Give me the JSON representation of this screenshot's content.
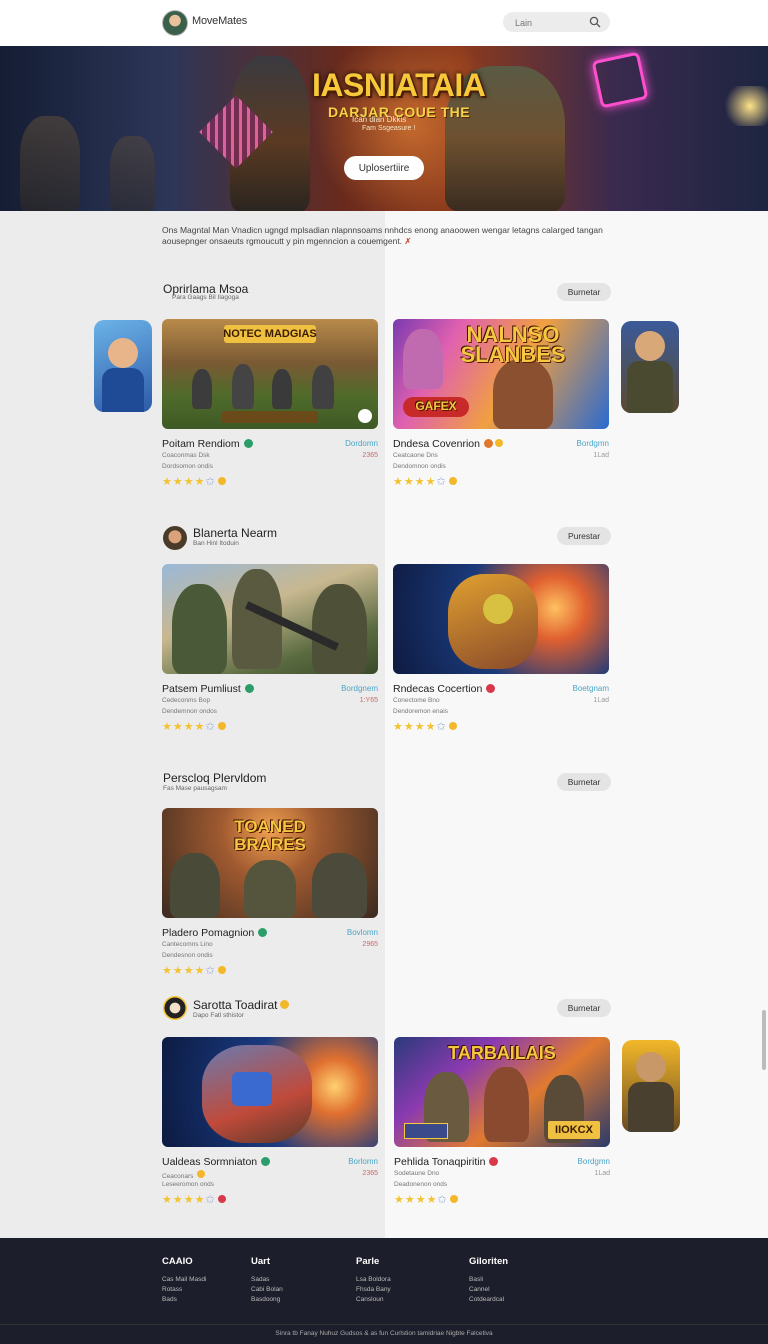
{
  "header": {
    "brand": "MoveMates",
    "search_placeholder": "Lain"
  },
  "hero": {
    "title_top": "DARJAR COUE THE",
    "title_main": "IASNIATAIA",
    "sub1": "Ican dian Dkkis",
    "sub2": "Fam Ssgeasure !",
    "button": "Uplosertiire"
  },
  "intro": {
    "text": "Ons Magntal Man Vnadicn ugngd mplsadian nlapnnsoams nnhdcs enong anaoowen wengar letagns calarged tangan aousepnger onsaeuts rgmoucutt y pin mgenncion a couemgent.",
    "tag": "✗"
  },
  "sections": [
    {
      "title": "Oprirlama Msoa",
      "subtitle": "Para Gaags Bil Ilagoga",
      "button": "Burnetar",
      "cards": [
        {
          "thumb_title": "NOTEC MADGIAS",
          "name": "Poitam Rendiom",
          "badge_color": "#2a9d6a",
          "link": "Dordomn",
          "num": "2365",
          "line1": "Coaconmas Dsk",
          "line2": "Dordsomon ondis"
        },
        {
          "thumb_title": "NALNSO SLANBES",
          "thumb_title2": "GAFEX",
          "name": "Dndesa Covenrion",
          "badge_color": "#e0782a",
          "link": "Bordgmn",
          "num": "1Lad",
          "line1": "Ceatcaone Dns",
          "line2": "Dendomnon ondis"
        }
      ]
    },
    {
      "title": "Blanerta Nearm",
      "subtitle": "Ban Hinl Itoduin",
      "button": "Purestar",
      "cards": [
        {
          "name": "Patsem Pumliust",
          "badge_color": "#2a9d6a",
          "link": "Bordgnem",
          "num": "1:Y65",
          "line1": "Cedeconms Bop",
          "line2": "Dendemnon ondos"
        },
        {
          "name": "Rndecas Cocertion",
          "badge_color": "#d9384a",
          "link": "Boetgnam",
          "num": "1Lad",
          "line1": "Conectome Bno",
          "line2": "Dendoremon enais"
        }
      ]
    },
    {
      "title": "Perscloq Plervldom",
      "subtitle": "Fas Mase pausagsam",
      "button": "Burnetar",
      "cards": [
        {
          "thumb_title": "TOANED BRARES",
          "name": "Pladero Pomagnion",
          "badge_color": "#2a9d6a",
          "link": "Bovlomn",
          "num": "2965",
          "line1": "Cantecomns Lino",
          "line2": "Dendesnon ondis"
        }
      ]
    },
    {
      "title": "Sarotta Toadirat",
      "subtitle": "Dapo Fatl sthistor",
      "button": "Burnetar",
      "cards": [
        {
          "name": "Ualdeas Sormniaton",
          "badge_color": "#2a9d6a",
          "link": "Borlomn",
          "num": "2365",
          "line1": "Ceaconars",
          "line2": "Leseeromon onds"
        },
        {
          "thumb_title": "TARBAILAIS",
          "thumb_title2": "IIOKCX",
          "name": "Pehlida Tonaqpiritin",
          "badge_color": "#d9384a",
          "link": "Bordgmn",
          "num": "1Lad",
          "line1": "Sodetaune Dno",
          "line2": "Deadonenon onds"
        }
      ]
    }
  ],
  "ratings": {
    "stars": "★★★★",
    "half": "✩"
  },
  "footer": {
    "cols": [
      {
        "head": "CAAIO",
        "links": [
          "Cas Mail Masdi",
          "Rotass",
          "Bads"
        ]
      },
      {
        "head": "Uart",
        "links": [
          "Sadas",
          "Cabi Bolan",
          "Basdoong"
        ]
      },
      {
        "head": "Parle",
        "links": [
          "Lsa Boldora",
          "Fhsda Bany",
          "Cansloun"
        ]
      },
      {
        "head": "Giloriten",
        "links": [
          "Basli",
          "Cannel",
          "Cotdeardcal"
        ]
      }
    ],
    "copyright": "Sinra tb Fanay Nuhuz Gudsos & as fun Curlstion tamidriae Nigbte Falcetiva"
  }
}
